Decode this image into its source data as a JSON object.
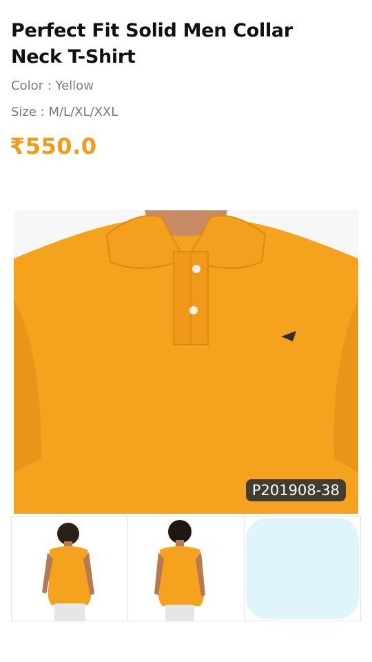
{
  "product": {
    "title": "Perfect Fit Solid Men Collar Neck T-Shirt",
    "color_text": "Color : Yellow",
    "size_text": "Size : M/L/XL/XXL",
    "price": "₹550.0",
    "sku": "P201908-38",
    "colors": {
      "shirt": "#f5a21f",
      "price": "#f59a16",
      "placeholder": "#e0f4fc"
    }
  },
  "gallery": {
    "thumbs": [
      {
        "icon": "front-view-photo"
      },
      {
        "icon": "back-view-photo"
      },
      {
        "icon": "placeholder"
      }
    ]
  }
}
